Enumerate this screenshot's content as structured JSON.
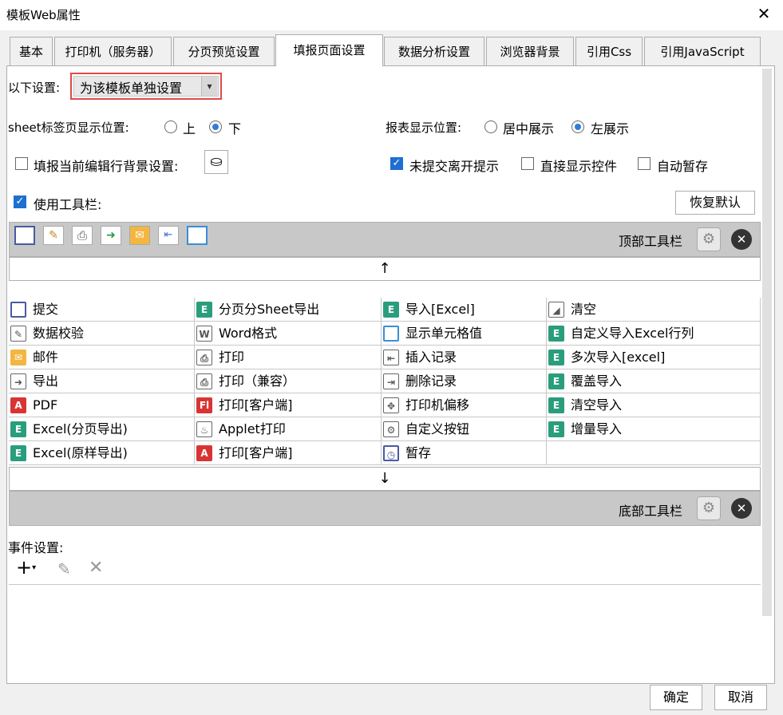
{
  "window": {
    "title": "模板Web属性"
  },
  "tabs": [
    {
      "label": "基本"
    },
    {
      "label": "打印机（服务器）"
    },
    {
      "label": "分页预览设置"
    },
    {
      "label": "填报页面设置"
    },
    {
      "label": "数据分析设置"
    },
    {
      "label": "浏览器背景"
    },
    {
      "label": "引用Css"
    },
    {
      "label": "引用JavaScript"
    }
  ],
  "settings": {
    "scope_label": "以下设置:",
    "scope_value": "为该模板单独设置",
    "sheet_pos_label": "sheet标签页显示位置:",
    "sheet_pos_top": "上",
    "sheet_pos_bottom": "下",
    "sheet_pos_selected": "下",
    "report_pos_label": "报表显示位置:",
    "report_pos_center": "居中展示",
    "report_pos_left": "左展示",
    "report_pos_selected": "左展示",
    "edit_row_bg_label": "填报当前编辑行背景设置:",
    "edit_row_bg_checked": false,
    "unsubmitted_leave_label": "未提交离开提示",
    "unsubmitted_leave_checked": true,
    "direct_show_label": "直接显示控件",
    "direct_show_checked": false,
    "auto_save_label": "自动暂存",
    "auto_save_checked": false,
    "use_toolbar_label": "使用工具栏:",
    "use_toolbar_checked": true,
    "restore_default": "恢复默认"
  },
  "top_toolbar": {
    "label": "顶部工具栏",
    "icons": [
      "save-icon",
      "pencil-check-icon",
      "printer-icon",
      "export-icon",
      "mail-icon",
      "insert-row-icon",
      "cell-value-icon"
    ]
  },
  "bottom_toolbar": {
    "label": "底部工具栏"
  },
  "arrows": {
    "up": "↑",
    "down": "↓"
  },
  "buttons_grid": [
    [
      {
        "icon": "save-icon",
        "glyph": "",
        "label": "提交"
      },
      {
        "icon": "excel-icon",
        "glyph": "E",
        "label": "分页分Sheet导出"
      },
      {
        "icon": "excel-icon",
        "glyph": "E",
        "label": "导入[Excel]"
      },
      {
        "icon": "eraser-icon",
        "glyph": "◢",
        "label": "清空"
      }
    ],
    [
      {
        "icon": "pencil-check-icon",
        "glyph": "✎",
        "label": "数据校验"
      },
      {
        "icon": "word-icon",
        "glyph": "W",
        "label": "Word格式"
      },
      {
        "icon": "cell-value-icon",
        "glyph": "",
        "label": "显示单元格值"
      },
      {
        "icon": "excel-icon",
        "glyph": "E",
        "label": "自定义导入Excel行列"
      }
    ],
    [
      {
        "icon": "mail-icon",
        "glyph": "✉",
        "label": "邮件"
      },
      {
        "icon": "printer-icon",
        "glyph": "⎙",
        "label": "打印"
      },
      {
        "icon": "insert-row-icon",
        "glyph": "⇤",
        "label": "插入记录"
      },
      {
        "icon": "excel-icon",
        "glyph": "E",
        "label": "多次导入[excel]"
      }
    ],
    [
      {
        "icon": "export-icon",
        "glyph": "➜",
        "label": "导出"
      },
      {
        "icon": "printer-icon",
        "glyph": "⎙",
        "label": "打印（兼容）"
      },
      {
        "icon": "delete-row-icon",
        "glyph": "⇥",
        "label": "删除记录"
      },
      {
        "icon": "excel-icon",
        "glyph": "E",
        "label": "覆盖导入"
      }
    ],
    [
      {
        "icon": "pdf-icon",
        "glyph": "A",
        "label": "PDF"
      },
      {
        "icon": "flash-print-icon",
        "glyph": "Fl",
        "label": "打印[客户端]"
      },
      {
        "icon": "move-icon",
        "glyph": "✥",
        "label": "打印机偏移"
      },
      {
        "icon": "excel-icon",
        "glyph": "E",
        "label": "清空导入"
      }
    ],
    [
      {
        "icon": "excel-icon",
        "glyph": "E",
        "label": "Excel(分页导出)"
      },
      {
        "icon": "applet-print-icon",
        "glyph": "♨",
        "label": "Applet打印"
      },
      {
        "icon": "gear-icon",
        "glyph": "⚙",
        "label": "自定义按钮"
      },
      {
        "icon": "excel-icon",
        "glyph": "E",
        "label": "增量导入"
      }
    ],
    [
      {
        "icon": "excel-icon",
        "glyph": "E",
        "label": "Excel(原样导出)"
      },
      {
        "icon": "pdf-print-icon",
        "glyph": "A",
        "label": "打印[客户端]"
      },
      {
        "icon": "temp-save-icon",
        "glyph": "◷",
        "label": "暂存"
      },
      {
        "icon": "",
        "glyph": "",
        "label": ""
      }
    ]
  ],
  "events": {
    "label": "事件设置:"
  },
  "footer": {
    "ok": "确定",
    "cancel": "取消"
  }
}
